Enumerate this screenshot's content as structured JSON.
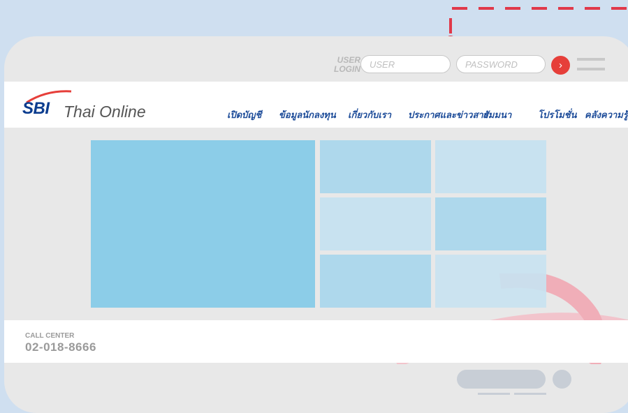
{
  "login": {
    "label_line1": "USER",
    "label_line2": "LOGIN",
    "user_placeholder": "USER",
    "password_placeholder": "PASSWORD",
    "submit_glyph": "›"
  },
  "brand": {
    "abbr": "SBI",
    "name": "Thai Online"
  },
  "nav": {
    "items": [
      "เปิดบัญชี",
      "ข้อมูลนักลงทุน",
      "เกี่ยวกับเรา",
      "ประกาศและข่าวสาร",
      "สัมมนา",
      "โปรโมชั่น",
      "คลังความรู้"
    ]
  },
  "footer": {
    "call_label": "CALL CENTER",
    "call_number": "02-018-8666"
  },
  "colors": {
    "accent_red": "#e63f3a",
    "brand_blue": "#0c3d8f",
    "nav_blue": "#1d4c99",
    "tile_main": "#8ccde8",
    "tile_mid": "#aed8ec",
    "tile_light": "#c8e2f0"
  },
  "icons": [
    "arrow-right-icon",
    "hamburger-menu-icon",
    "sbi-logo-swoosh"
  ]
}
